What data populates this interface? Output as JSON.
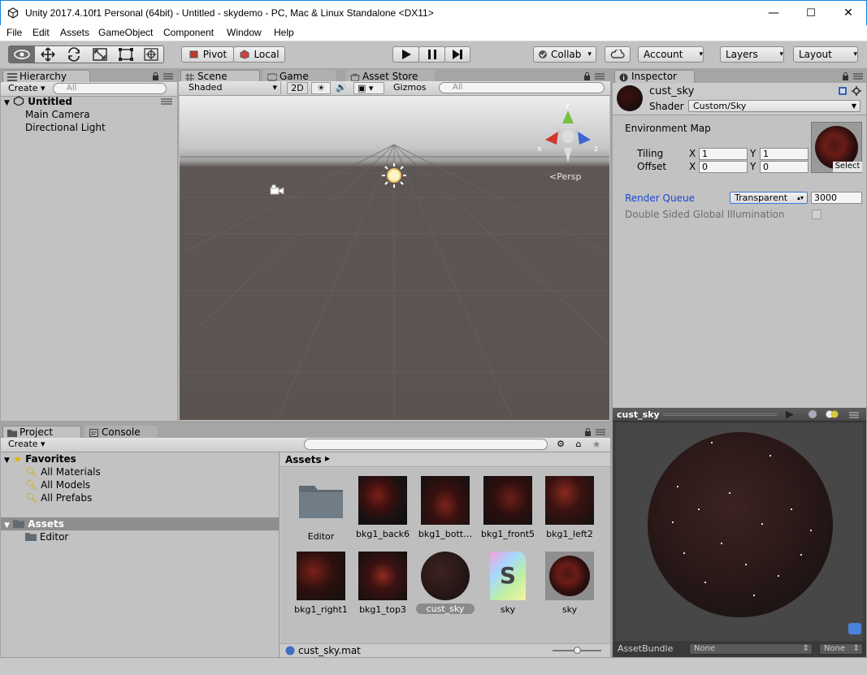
{
  "window": {
    "title": "Unity 2017.4.10f1 Personal (64bit) - Untitled - skydemo - PC, Mac & Linux Standalone <DX11>",
    "minimize": "—",
    "maximize": "☐",
    "close": "✕"
  },
  "menu": [
    "File",
    "Edit",
    "Assets",
    "GameObject",
    "Component",
    "Window",
    "Help"
  ],
  "toolbar": {
    "pivot": "Pivot",
    "local": "Local",
    "collab": "Collab",
    "account": "Account",
    "layers": "Layers",
    "layout": "Layout"
  },
  "hierarchy": {
    "tab": "Hierarchy",
    "create": "Create",
    "search_placeholder": "All",
    "scene": "Untitled",
    "items": [
      "Main Camera",
      "Directional Light"
    ]
  },
  "scene": {
    "tabs": [
      "Scene",
      "Game",
      "Asset Store"
    ],
    "shading": "Shaded",
    "mode2d": "2D",
    "gizmos": "Gizmos",
    "search_placeholder": "All",
    "persp": "Persp",
    "axes": {
      "x": "x",
      "y": "y",
      "z": "z"
    }
  },
  "inspector": {
    "tab": "Inspector",
    "name": "cust_sky",
    "shader_label": "Shader",
    "shader_value": "Custom/Sky",
    "env_map": "Environment Map",
    "tiling": "Tiling",
    "offset": "Offset",
    "x": "X",
    "y": "Y",
    "tiling_x": "1",
    "tiling_y": "1",
    "offset_x": "0",
    "offset_y": "0",
    "select": "Select",
    "render_queue": "Render Queue",
    "render_queue_mode": "Transparent",
    "render_queue_value": "3000",
    "dsgi": "Double Sided Global Illumination"
  },
  "preview": {
    "title": "cust_sky",
    "assetbundle": "AssetBundle",
    "none1": "None",
    "none2": "None"
  },
  "project": {
    "tabs": [
      "Project",
      "Console"
    ],
    "create": "Create",
    "favorites": "Favorites",
    "fav_items": [
      "All Materials",
      "All Models",
      "All Prefabs"
    ],
    "assets": "Assets",
    "folders": [
      "Editor"
    ],
    "breadcrumb": "Assets",
    "grid": [
      "Editor",
      "bkg1_back6",
      "bkg1_bott…",
      "bkg1_front5",
      "bkg1_left2",
      "bkg1_right1",
      "bkg1_top3",
      "cust_sky",
      "sky",
      "sky"
    ],
    "status_file": "cust_sky.mat"
  },
  "colors": {
    "accent_blue": "#1a47d6",
    "selection": "#3d79d9",
    "panel": "#c2c2c2"
  }
}
